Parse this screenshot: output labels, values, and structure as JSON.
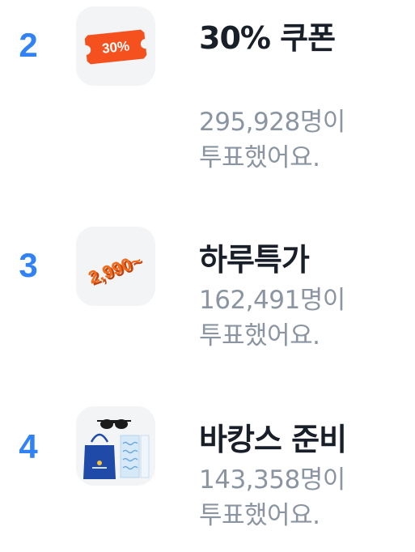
{
  "items": [
    {
      "rank": "2",
      "title": "30% 쿠폰",
      "votes_line1": "295,928명이",
      "votes_line2": "투표했어요.",
      "image_text": "30%",
      "image_name": "coupon-ticket-image"
    },
    {
      "rank": "3",
      "title": "하루특가",
      "votes_line1": "162,491명이",
      "votes_line2": "투표했어요.",
      "image_text": "2,990~",
      "image_name": "price-tag-image"
    },
    {
      "rank": "4",
      "title": "바캉스 준비",
      "votes_line1": "143,358명이",
      "votes_line2": "투표했어요.",
      "image_name": "vacation-goods-image"
    }
  ],
  "colors": {
    "rank": "#3182f6",
    "title": "#191f28",
    "subtitle": "#8b95a1",
    "thumb_bg": "#f2f4f6",
    "coupon": "#f4511e"
  }
}
